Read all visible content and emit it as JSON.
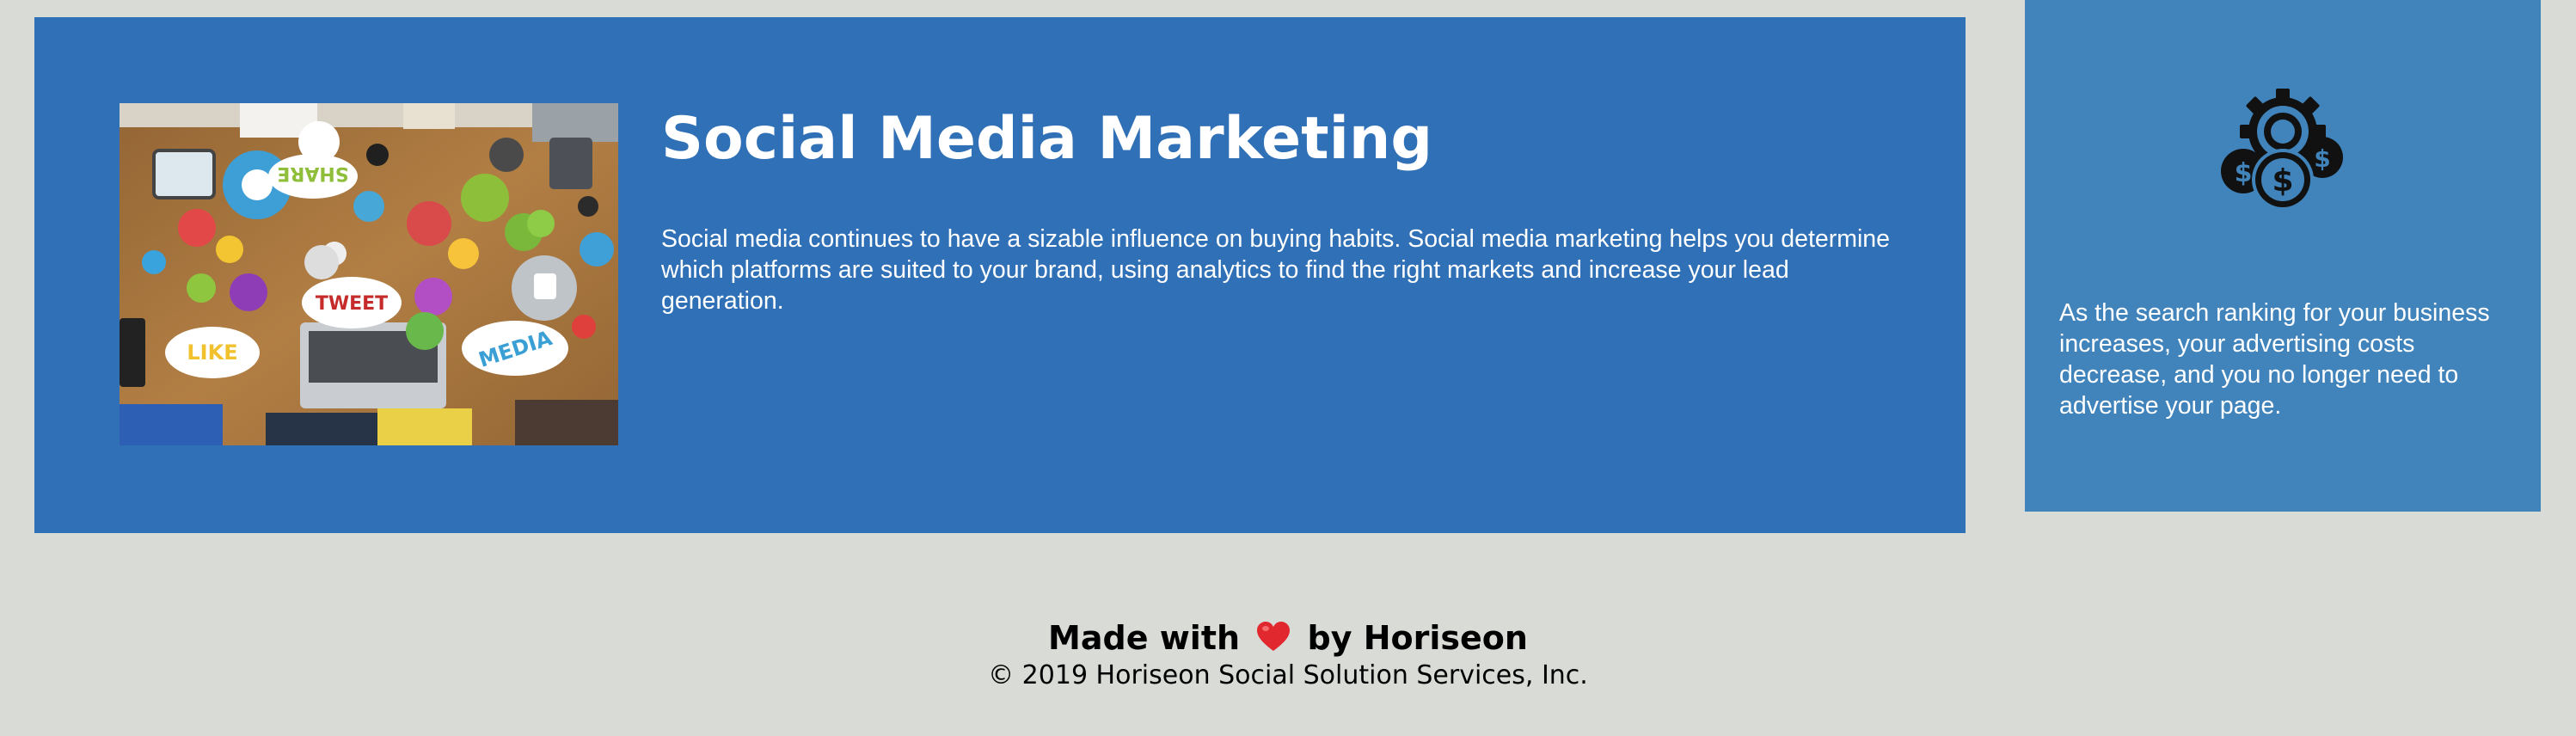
{
  "services": {
    "social_media": {
      "title": "Social Media Marketing",
      "description": "Social media continues to have a sizable influence on buying habits. Social media marketing helps you determine which platforms are suited to your brand, using analytics to find the right markets and increase your lead generation.",
      "image_icon": "social-media-marketing-image",
      "image_words": [
        "SHARE",
        "TWEET",
        "LIKE",
        "MEDIA"
      ]
    }
  },
  "benefits": {
    "cost": {
      "icon": "cost-savings-icon",
      "text": "As the search ranking for your business increases, your advertising costs decrease, and you no longer need to advertise your page."
    }
  },
  "footer": {
    "made_prefix": "Made with",
    "heart_icon": "heart-icon",
    "made_suffix": "by Horiseon",
    "copyright": "© 2019 Horiseon Social Solution Services, Inc."
  },
  "colors": {
    "page_background": "#d9dcd6",
    "content_card": "#2f70b6",
    "benefit_card": "#4184bb",
    "heart": "#e0282e"
  }
}
